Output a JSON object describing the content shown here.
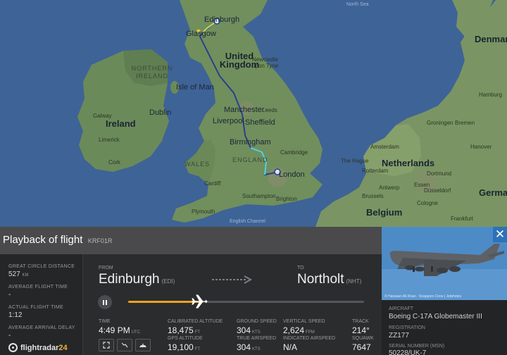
{
  "map": {
    "countries": [
      "United Kingdom",
      "Ireland",
      "NORTHERN IRELAND",
      "WALES",
      "ENGLAND",
      "Netherlands",
      "Belgium",
      "Denmark",
      "Germany"
    ],
    "cities": [
      "Edinburgh",
      "Glasgow",
      "Isle of Man",
      "Newcastle upon Tyne",
      "Dublin",
      "Galway",
      "Cork",
      "Limerick",
      "Manchester",
      "Liverpool",
      "Leeds",
      "Sheffield",
      "Birmingham",
      "Cambridge",
      "London",
      "Southampton",
      "Brighton",
      "Plymouth",
      "Cardiff",
      "Amsterdam",
      "The Hague",
      "Rotterdam",
      "Antwerp",
      "Brussels",
      "Essen",
      "Dortmund",
      "Düsseldorf",
      "Cologne",
      "Frankfurt",
      "Bremen",
      "Hamburg",
      "Hanover",
      "Groningen"
    ],
    "seas": [
      "North Sea",
      "English Channel"
    ],
    "sea_color": "#3e6396",
    "land_color": "#6d8a5c",
    "route_colors": [
      "#2b3f8c",
      "#55d6e8",
      "#c9d65a"
    ]
  },
  "panel": {
    "title": "Playback of flight",
    "callsign": "KRF01R",
    "stats": [
      {
        "label": "GREAT CIRCLE DISTANCE",
        "value": "527",
        "unit": "KM"
      },
      {
        "label": "AVERAGE FLIGHT TIME",
        "value": "-"
      },
      {
        "label": "ACTUAL FLIGHT TIME",
        "value": "1:12"
      },
      {
        "label": "AVERAGE ARRIVAL DELAY",
        "value": "-"
      }
    ],
    "from_label": "FROM",
    "from_city": "Edinburgh",
    "from_code": "(EDI)",
    "to_label": "TO",
    "to_city": "Northolt",
    "to_code": "(NHT)",
    "progress": 0.3,
    "time": {
      "label": "TIME",
      "value": "4:49 PM",
      "unit": "UTC"
    },
    "metrics": [
      {
        "label": "CALIBRATED ALTITUDE",
        "value": "18,475",
        "unit": "FT"
      },
      {
        "label": "GPS ALTITUDE",
        "value": "19,100",
        "unit": "FT"
      },
      {
        "label": "GROUND SPEED",
        "value": "304",
        "unit": "KTS"
      },
      {
        "label": "TRUE AIRSPEED",
        "value": "304",
        "unit": "KTS"
      },
      {
        "label": "VERTICAL SPEED",
        "value": "2,624",
        "unit": "FPM"
      },
      {
        "label": "INDICATED AIRSPEED",
        "value": "N/A"
      },
      {
        "label": "TRACK",
        "value": "214°"
      },
      {
        "label": "SQUAWK",
        "value": "7647"
      }
    ],
    "logo_main": "flightradar",
    "logo_suffix": "24"
  },
  "aircraft": {
    "photo_credit": "© Hassaan Ali Khan - Snappers Crew | Jetphotos",
    "close": "✕",
    "aircraft_label": "AIRCRAFT",
    "aircraft_value": "Boeing C-17A Globemaster III",
    "reg_label": "REGISTRATION",
    "reg_value": "ZZ177",
    "serial_label": "SERIAL NUMBER (MSN)",
    "serial_value": "50228/UK-7"
  }
}
